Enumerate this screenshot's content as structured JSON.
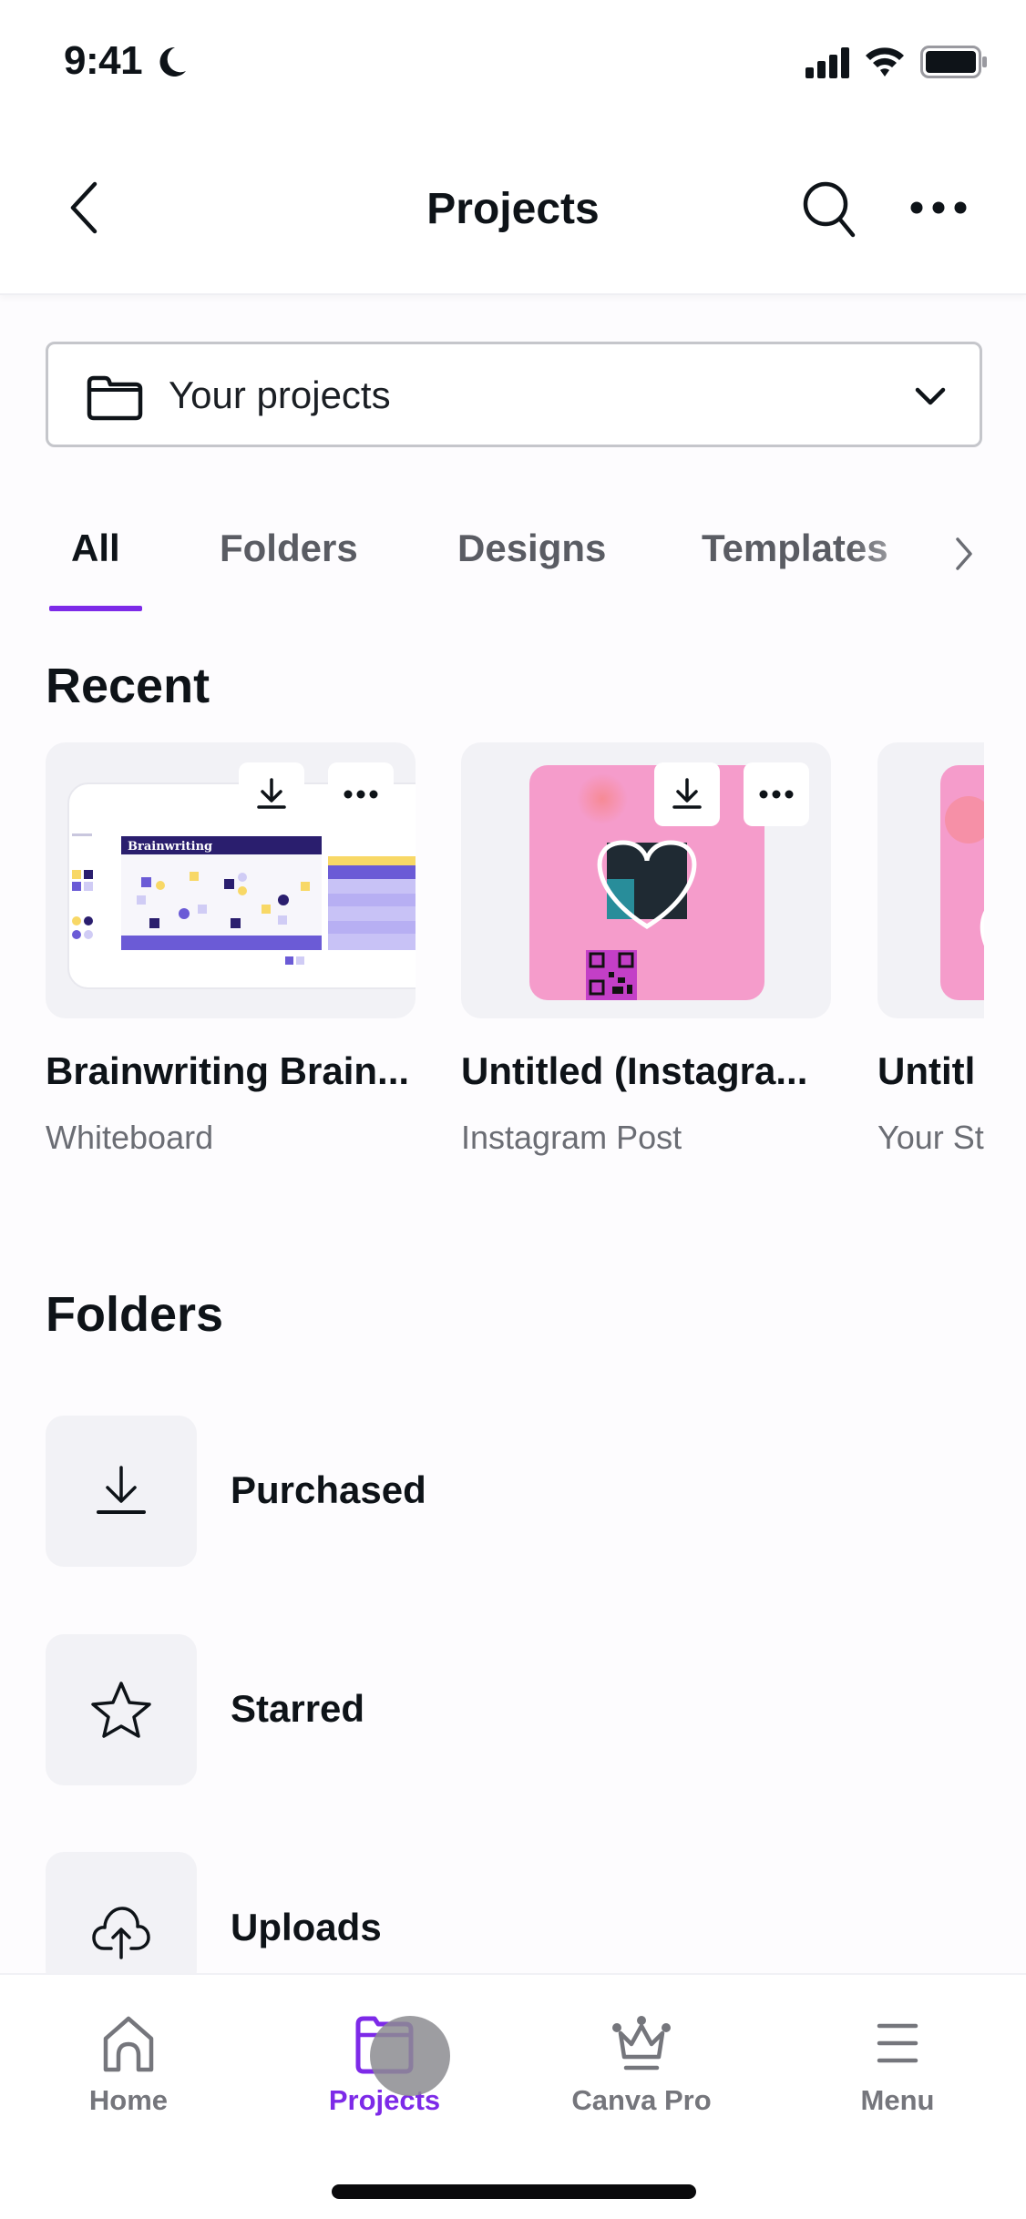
{
  "status_bar": {
    "time": "9:41",
    "icons": [
      "moon-icon",
      "cellular-signal-icon",
      "wifi-icon",
      "battery-icon"
    ]
  },
  "header": {
    "title": "Projects",
    "back_icon": "chevron-left-icon",
    "search_icon": "search-icon",
    "more_icon": "ellipsis-icon"
  },
  "dropdown": {
    "icon": "folder-icon",
    "selected": "Your projects",
    "chevron_icon": "chevron-down-icon"
  },
  "tabs": {
    "items": [
      {
        "label": "All",
        "active": true
      },
      {
        "label": "Folders",
        "active": false
      },
      {
        "label": "Designs",
        "active": false
      },
      {
        "label": "Templates",
        "active": false
      }
    ],
    "more_icon": "chevron-right-icon"
  },
  "recent": {
    "title": "Recent",
    "items": [
      {
        "title": "Brainwriting Brain...",
        "subtitle": "Whiteboard",
        "thumb_heading": "Brainwriting"
      },
      {
        "title": "Untitled (Instagra...",
        "subtitle": "Instagram Post"
      },
      {
        "title": "Untitl",
        "subtitle": "Your St"
      }
    ]
  },
  "folders": {
    "title": "Folders",
    "items": [
      {
        "label": "Purchased",
        "icon": "download-icon"
      },
      {
        "label": "Starred",
        "icon": "star-icon"
      },
      {
        "label": "Uploads",
        "icon": "cloud-upload-icon"
      }
    ]
  },
  "bottom_nav": {
    "items": [
      {
        "label": "Home",
        "icon": "home-icon",
        "active": false
      },
      {
        "label": "Projects",
        "icon": "folder-icon",
        "active": true
      },
      {
        "label": "Canva Pro",
        "icon": "crown-icon",
        "active": false
      },
      {
        "label": "Menu",
        "icon": "hamburger-menu-icon",
        "active": false
      }
    ]
  },
  "colors": {
    "accent": "#7d2ae8",
    "text_primary": "#0e1318",
    "text_secondary": "#6b6d74",
    "tile_background": "#f2f2f6",
    "thumb_pink": "#f59ccb",
    "thumb_navy": "#2a1e6e",
    "thumb_purple": "#6b5bd6"
  }
}
